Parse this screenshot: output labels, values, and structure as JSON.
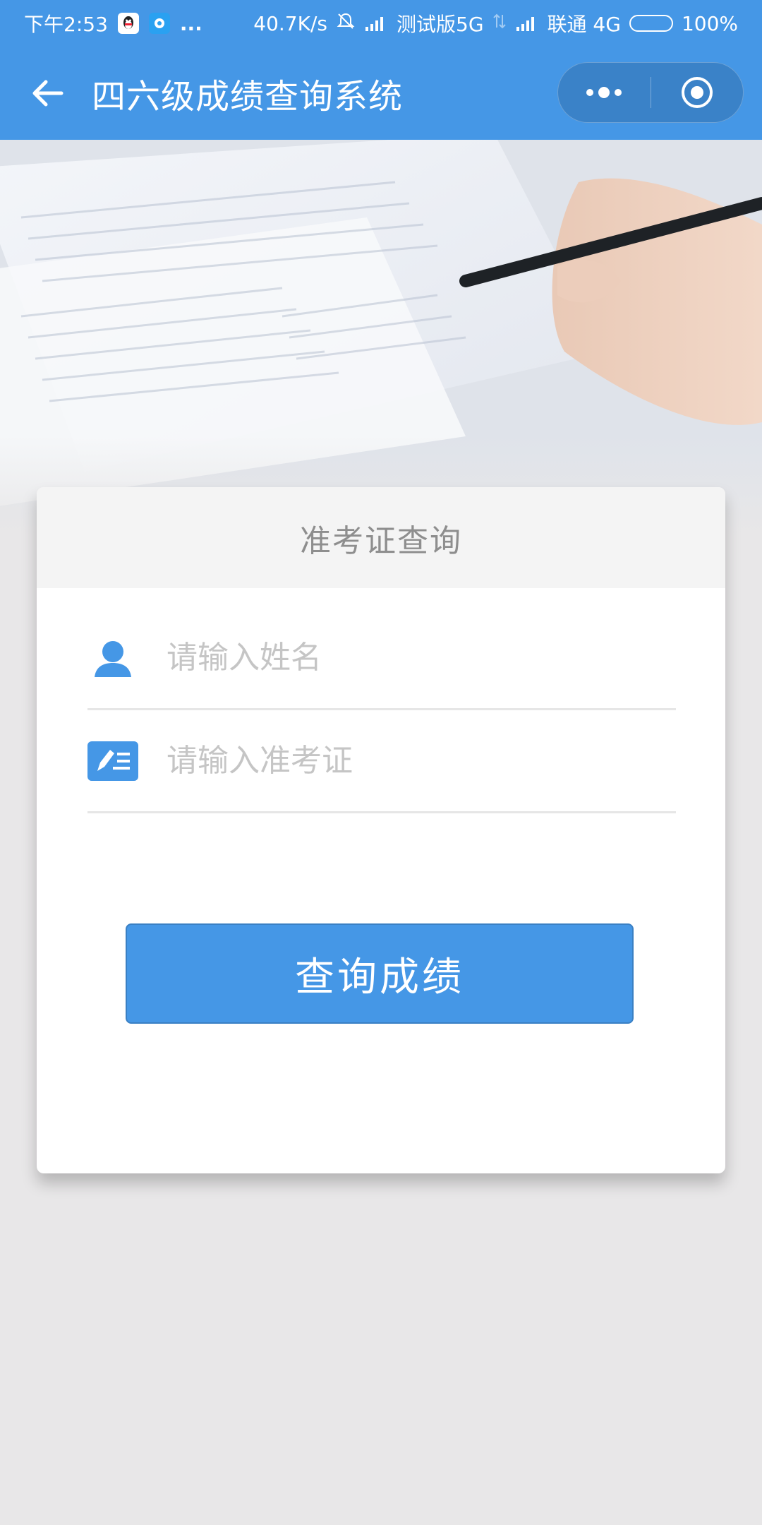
{
  "status_bar": {
    "time": "下午2:53",
    "more": "...",
    "speed": "40.7K/s",
    "carrier1": "测试版5G",
    "carrier2": "联通 4G",
    "battery": "100%"
  },
  "nav": {
    "title": "四六级成绩查询系统",
    "back_icon": "back-arrow-icon",
    "more_icon": "more-dots-icon",
    "close_icon": "target-circle-icon"
  },
  "card": {
    "header": "准考证查询",
    "name_placeholder": "请输入姓名",
    "ticket_placeholder": "请输入准考证",
    "submit_label": "查询成绩"
  },
  "colors": {
    "primary": "#4597e6",
    "background": "#e8e7e8",
    "header_bg": "#f4f4f4"
  }
}
